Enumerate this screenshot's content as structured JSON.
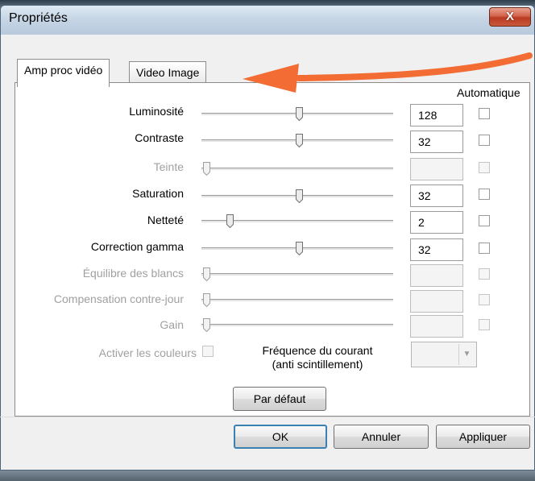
{
  "window": {
    "title": "Propriétés",
    "close_label": "X"
  },
  "tabs": [
    {
      "label": "Amp proc vidéo",
      "active": true
    },
    {
      "label": "Video Image",
      "active": false
    }
  ],
  "auto_header": "Automatique",
  "controls": [
    {
      "label": "Luminosité",
      "value": "128",
      "enabled": true
    },
    {
      "label": "Contraste",
      "value": "32",
      "enabled": true
    },
    {
      "label": "Teinte",
      "value": "",
      "enabled": false
    },
    {
      "label": "Saturation",
      "value": "32",
      "enabled": true
    },
    {
      "label": "Netteté",
      "value": "2",
      "enabled": true
    },
    {
      "label": "Correction gamma",
      "value": "32",
      "enabled": true
    },
    {
      "label": "Équilibre des blancs",
      "value": "",
      "enabled": false
    },
    {
      "label": "Compensation contre-jour",
      "value": "",
      "enabled": false
    },
    {
      "label": "Gain",
      "value": "",
      "enabled": false
    }
  ],
  "color_enable_label": "Activer les couleurs",
  "frequency": {
    "line1": "Fréquence du courant",
    "line2": "(anti scintillement)",
    "value": ""
  },
  "buttons": {
    "default": "Par défaut",
    "ok": "OK",
    "cancel": "Annuler",
    "apply": "Appliquer"
  },
  "colors": {
    "arrow": "#f26c33",
    "close_button": "#c9452a",
    "default_focus": "#3c7fb1"
  }
}
